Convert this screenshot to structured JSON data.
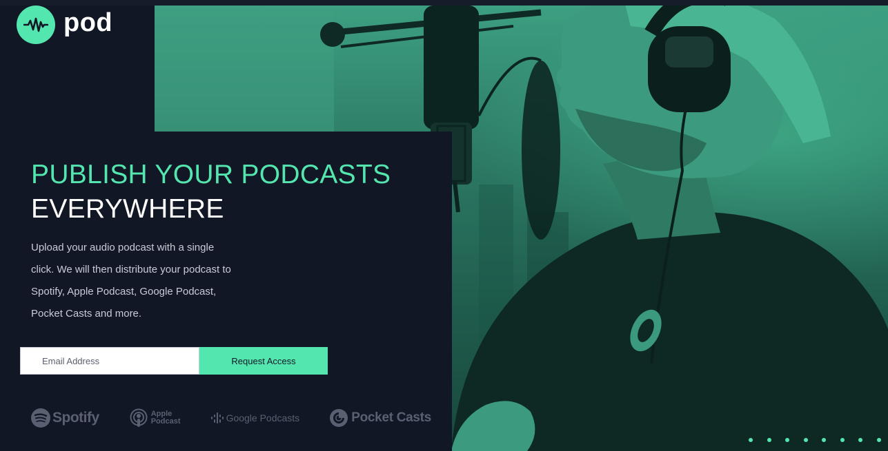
{
  "brand": {
    "name": "pod",
    "logo_icon": "waveform-icon",
    "accent_color": "#54e6af",
    "background_color": "#121725"
  },
  "hero": {
    "headline_line1": "PUBLISH YOUR PODCASTS",
    "headline_line2": "EVERYWHERE",
    "description": "Upload your audio podcast with a single click. We will then distribute your podcast to Spotify, Apple Podcast, Google Podcast, Pocket Casts and more.",
    "image_icon": "podcaster-microphone-photo"
  },
  "signup": {
    "email_placeholder": "Email Address",
    "email_value": "",
    "button_label": "Request Access"
  },
  "partners": [
    {
      "name": "Spotify",
      "icon": "spotify-icon"
    },
    {
      "name_line1": "Apple",
      "name_line2": "Podcast",
      "icon": "apple-podcast-icon"
    },
    {
      "name": "Google Podcasts",
      "icon": "google-podcasts-icon"
    },
    {
      "name": "Pocket Casts",
      "icon": "pocket-casts-icon"
    }
  ]
}
